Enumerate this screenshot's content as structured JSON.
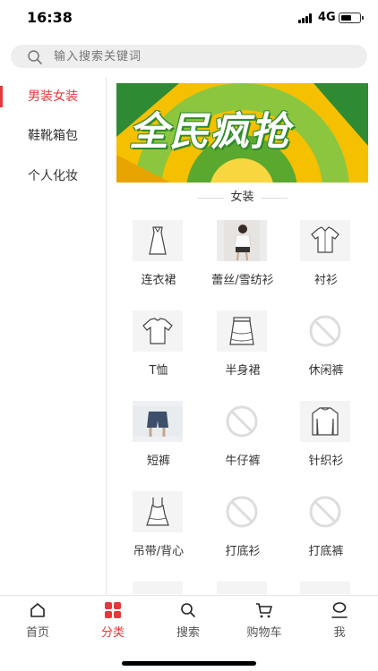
{
  "status": {
    "time": "16:38",
    "network": "4G",
    "battery_level": 0.55
  },
  "search": {
    "placeholder": "输入搜索关键词"
  },
  "sidebar": {
    "items": [
      {
        "label": "男装女装",
        "active": true
      },
      {
        "label": "鞋靴箱包",
        "active": false
      },
      {
        "label": "个人化妆",
        "active": false
      }
    ]
  },
  "banner": {
    "text": "全民疯抢"
  },
  "section": {
    "title": "女装"
  },
  "categories": [
    {
      "label": "连衣裙",
      "icon": "dress-icon"
    },
    {
      "label": "蕾丝/雪纺衫",
      "icon": "model-photo"
    },
    {
      "label": "衬衫",
      "icon": "shirt-icon"
    },
    {
      "label": "T恤",
      "icon": "tshirt-icon"
    },
    {
      "label": "半身裙",
      "icon": "skirt-icon"
    },
    {
      "label": "休闲裤",
      "icon": "no-picture-icon"
    },
    {
      "label": "短裤",
      "icon": "shorts-photo"
    },
    {
      "label": "牛仔裤",
      "icon": "no-picture-icon"
    },
    {
      "label": "针织衫",
      "icon": "sweater-icon"
    },
    {
      "label": "吊带/背心",
      "icon": "camisole-icon"
    },
    {
      "label": "打底衫",
      "icon": "no-picture-icon"
    },
    {
      "label": "打底裤",
      "icon": "no-picture-icon"
    }
  ],
  "tabs": [
    {
      "label": "首页",
      "icon": "home-icon",
      "active": false
    },
    {
      "label": "分类",
      "icon": "category-icon",
      "active": true
    },
    {
      "label": "搜索",
      "icon": "search-icon",
      "active": false
    },
    {
      "label": "购物车",
      "icon": "cart-icon",
      "active": false
    },
    {
      "label": "我",
      "icon": "user-icon",
      "active": false
    }
  ],
  "colors": {
    "accent": "#e4393c",
    "banner_green": "#2f8a2a",
    "banner_yellow": "#f3b800"
  }
}
